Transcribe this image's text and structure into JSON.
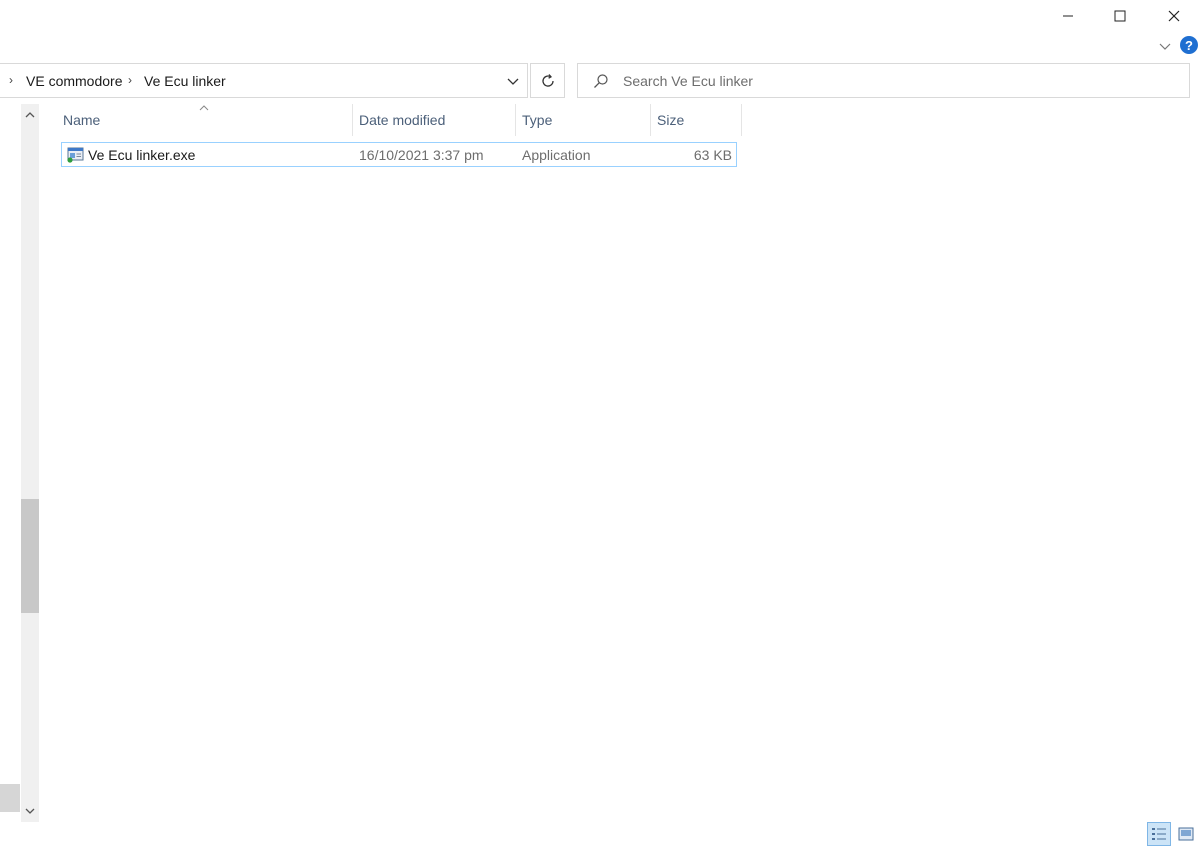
{
  "window": {
    "minimize_label": "—",
    "maximize_label": "☐",
    "close_label": "✕",
    "help_label": "?"
  },
  "address": {
    "crumbs": [
      "VE commodore",
      "Ve Ecu linker"
    ],
    "separator": "›"
  },
  "search": {
    "placeholder": "Search Ve Ecu linker"
  },
  "columns": {
    "name": "Name",
    "date_modified": "Date modified",
    "type": "Type",
    "size": "Size"
  },
  "files": [
    {
      "name": "Ve Ecu linker.exe",
      "date_modified": "16/10/2021 3:37 pm",
      "type": "Application",
      "size": "63 KB",
      "icon": "application-exe-icon"
    }
  ],
  "status": {
    "view_details_icon": "details-view-icon",
    "view_large_icon": "large-icons-view-icon"
  },
  "colors": {
    "accent": "#1f6fd1",
    "selection_border": "#99d1ff",
    "header_text": "#4c607a"
  }
}
